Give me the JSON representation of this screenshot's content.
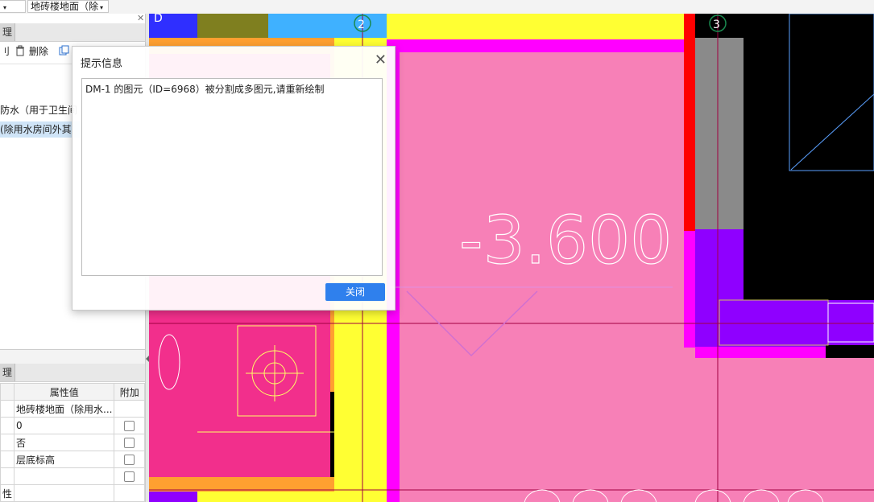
{
  "toolbar": {
    "combo1_label": "",
    "combo2_label": "地砖楼地面（除",
    "chevron": "▾"
  },
  "left_panel": {
    "top_tab": "理",
    "pin_glyph": "✕",
    "toolbar_items": {
      "copy_partial": "刂",
      "delete": "删除"
    },
    "list": [
      {
        "label": "防水（用于卫生间",
        "selected": false
      },
      {
        "label": "(除用水房间外其",
        "selected": true
      }
    ]
  },
  "prop_panel": {
    "tab": "理",
    "headers": {
      "value": "属性值",
      "attach": "附加"
    },
    "rows": [
      {
        "key": "",
        "value": "地砖楼地面（除用水...",
        "checkbox": false
      },
      {
        "key": "",
        "value": "0",
        "checkbox": true
      },
      {
        "key": "",
        "value": "否",
        "checkbox": true
      },
      {
        "key": "",
        "value": "层底标高",
        "checkbox": true
      },
      {
        "key": "",
        "value": "",
        "checkbox": true
      },
      {
        "key": "性",
        "value": "",
        "checkbox": false
      }
    ]
  },
  "canvas": {
    "elevation_text": "-3.600",
    "grid_labels": [
      "D",
      "2",
      "3"
    ],
    "colors": {
      "pink": "#f780b7",
      "magenta": "#ff00ff",
      "yellow": "#ffff33",
      "orange": "#ffa030",
      "blue": "#3d7bff",
      "cyan": "#3fb1ff",
      "olive": "#7f7f1f",
      "red": "#ff0000",
      "purple": "#8f00ff",
      "gray": "#8a8a8a",
      "hotpink": "#f22f8c"
    }
  },
  "dialog": {
    "title": "提示信息",
    "message": "DM-1 的图元（ID=6968）被分割成多图元,请重新绘制",
    "close_button": "关闭",
    "close_glyph": "✕"
  }
}
